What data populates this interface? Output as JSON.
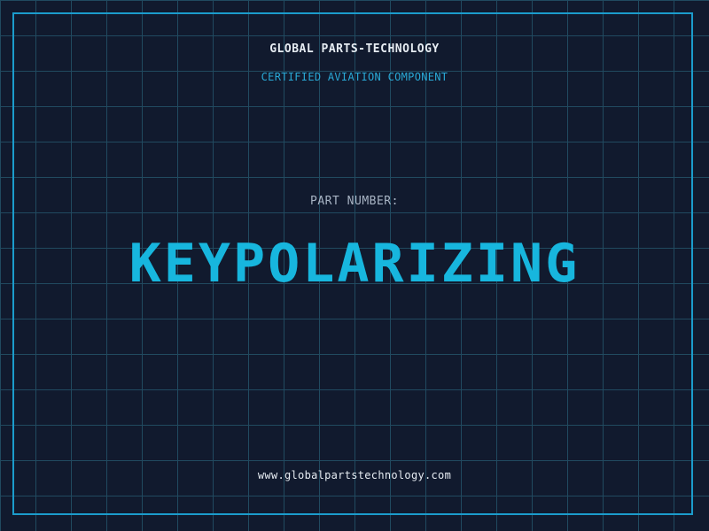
{
  "header": {
    "company": "GLOBAL PARTS-TECHNOLOGY",
    "tagline": "CERTIFIED AVIATION COMPONENT"
  },
  "main": {
    "label": "PART NUMBER:",
    "part_number": "KEYPOLARIZING"
  },
  "footer": {
    "website": "www.globalpartstechnology.com"
  },
  "colors": {
    "background": "#111a2e",
    "grid": "#214a60",
    "frame": "#1b9ccc",
    "accent": "#17b6de",
    "text": "#e6ecf2"
  }
}
